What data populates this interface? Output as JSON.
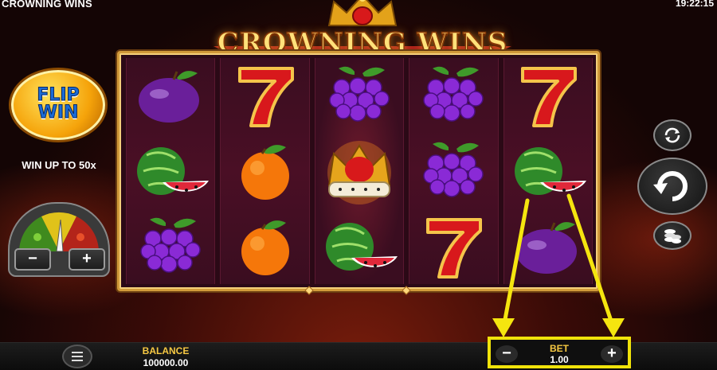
{
  "header": {
    "game_title": "CROWNING WINS",
    "clock": "19:22:15"
  },
  "logo": {
    "title": "CROWNING WINS"
  },
  "feature": {
    "badge_line1": "FLIP",
    "badge_line2": "WIN",
    "promo": "WIN UP TO 50x"
  },
  "meter": {
    "minus": "−",
    "plus": "+"
  },
  "reels": [
    [
      "plum",
      "watermelon",
      "grapes"
    ],
    [
      "seven",
      "orange",
      "orange"
    ],
    [
      "grapes",
      "crown",
      "watermelon"
    ],
    [
      "grapes",
      "grapes",
      "seven"
    ],
    [
      "seven",
      "watermelon",
      "plum"
    ]
  ],
  "controls": {
    "right_buttons": [
      "autoplay-icon",
      "spin-icon",
      "coins-icon"
    ],
    "menu": "hamburger-icon"
  },
  "balance": {
    "label": "BALANCE",
    "value": "100000.00"
  },
  "bet": {
    "label": "BET",
    "value": "1.00",
    "minus": "−",
    "plus": "+"
  },
  "colors": {
    "accent_yellow": "#f0e30a",
    "gold": "#f6c842",
    "reel_bg": "#3a0d20"
  }
}
